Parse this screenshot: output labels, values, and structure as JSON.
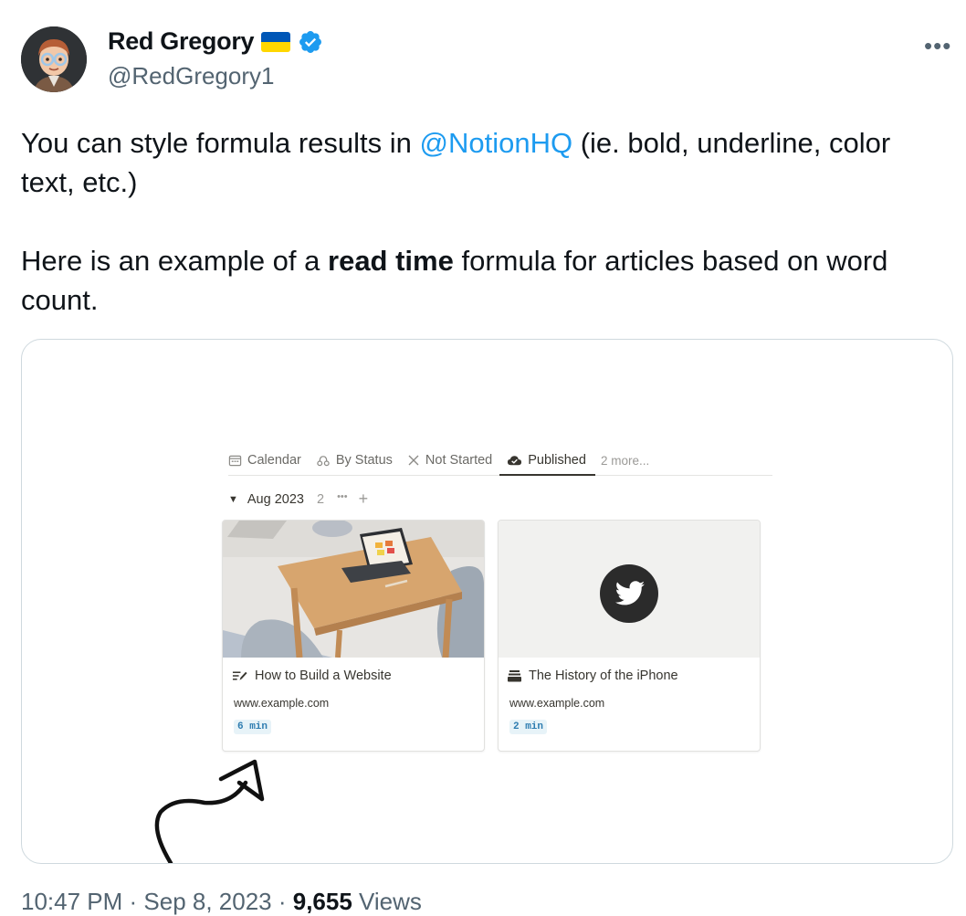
{
  "author": {
    "display_name": "Red Gregory",
    "flag": "ukraine-flag-icon",
    "handle": "@RedGregory1",
    "verified": true
  },
  "more_label": "•••",
  "tweet": {
    "text_before_mention": "You can style formula results in ",
    "mention": "@NotionHQ",
    "text_after_mention": " (ie. bold, underline, color text, etc.)",
    "p2_before_bold": "Here is an example of a ",
    "p2_bold": "read time",
    "p2_after_bold": " formula for articles based on word count."
  },
  "media": {
    "tabs": [
      {
        "label": "Calendar",
        "icon": "calendar-icon"
      },
      {
        "label": "By Status",
        "icon": "status-icon"
      },
      {
        "label": "Not Started",
        "icon": "x-icon"
      },
      {
        "label": "Published",
        "icon": "cloud-check-icon",
        "active": true
      },
      {
        "label": "2 more...",
        "icon": ""
      }
    ],
    "group": {
      "label": "Aug 2023",
      "count": "2",
      "more": "•••",
      "add": "+"
    },
    "cards": [
      {
        "title": "How to Build a Website",
        "icon": "article-icon",
        "url": "www.example.com",
        "badge": "6 min",
        "cover": "desk-photo"
      },
      {
        "title": "The History of the iPhone",
        "icon": "stack-icon",
        "url": "www.example.com",
        "badge": "2 min",
        "cover": "twitter-logo-icon"
      }
    ]
  },
  "footer": {
    "time": "10:47 PM · Sep 8, 2023 · ",
    "views_count": "9,655",
    "views_label": " Views"
  },
  "colors": {
    "link": "#1d9bf0",
    "verified": "#1d9bf0",
    "muted": "#536471"
  }
}
